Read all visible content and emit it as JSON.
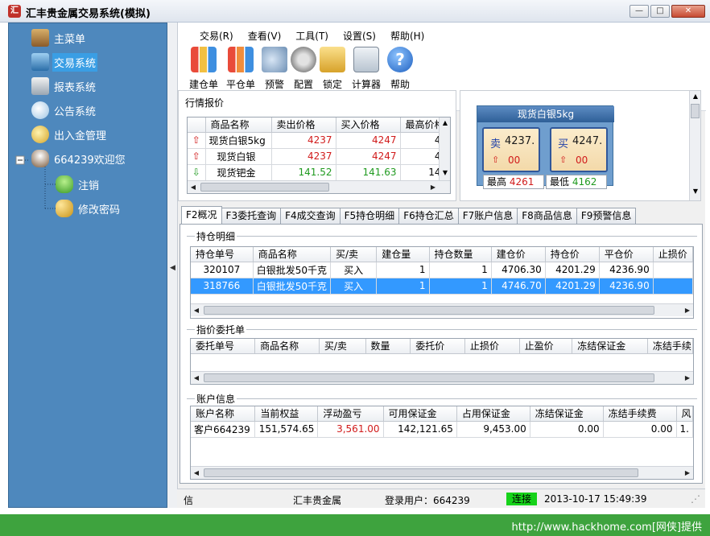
{
  "window": {
    "app_icon": "汇",
    "title": "汇丰贵金属交易系统(模拟)",
    "btn_min": "—",
    "btn_max": "□",
    "btn_close": "✕"
  },
  "sidebar": {
    "items": [
      {
        "label": "主菜单",
        "icon": "home-icon"
      },
      {
        "label": "交易系统",
        "icon": "monitor-icon"
      },
      {
        "label": "报表系统",
        "icon": "report-icon"
      },
      {
        "label": "公告系统",
        "icon": "chat-bubble-icon"
      },
      {
        "label": "出入金管理",
        "icon": "coins-icon"
      },
      {
        "label": "664239欢迎您",
        "icon": "cup-icon"
      },
      {
        "label": "注销",
        "icon": "user-icon"
      },
      {
        "label": "修改密码",
        "icon": "key-icon"
      }
    ],
    "selected": "交易系统"
  },
  "menubar": [
    "交易(R)",
    "查看(V)",
    "工具(T)",
    "设置(S)",
    "帮助(H)"
  ],
  "toolbar": [
    "建仓单",
    "平仓单",
    "预警",
    "配置",
    "锁定",
    "计算器",
    "帮助"
  ],
  "quotes": {
    "title": "行情报价",
    "columns": [
      "商品名称",
      "卖出价格",
      "买入价格",
      "最高价格"
    ],
    "rows": [
      {
        "dir": "up",
        "name": "现货白银5kg",
        "sell": "4237",
        "buy": "4247",
        "high": "4"
      },
      {
        "dir": "up",
        "name": "现货白银",
        "sell": "4237",
        "buy": "4247",
        "high": "4"
      },
      {
        "dir": "down",
        "name": "现货钯金",
        "sell": "141.52",
        "buy": "141.63",
        "high": "14"
      }
    ]
  },
  "ticker": {
    "title": "现货白银5kg",
    "sell_label": "卖",
    "sell_price": "4237.",
    "sell_change": "00",
    "buy_label": "买",
    "buy_price": "4247.",
    "buy_change": "00",
    "high_label": "最高",
    "high_value": "4261",
    "low_label": "最低",
    "low_value": "4162"
  },
  "tabs": [
    "F2概况",
    "F3委托查询",
    "F4成交查询",
    "F5持仓明细",
    "F6持仓汇总",
    "F7账户信息",
    "F8商品信息",
    "F9预警信息"
  ],
  "positions": {
    "title": "持仓明细",
    "columns": [
      "持仓单号",
      "商品名称",
      "买/卖",
      "建仓量",
      "持仓数量",
      "建仓价",
      "持仓价",
      "平仓价",
      "止损价"
    ],
    "rows": [
      [
        "320107",
        "白银批发50千克",
        "买入",
        "1",
        "1",
        "4706.30",
        "4201.29",
        "4236.90"
      ],
      [
        "318766",
        "白银批发50千克",
        "买入",
        "1",
        "1",
        "4746.70",
        "4201.29",
        "4236.90"
      ]
    ]
  },
  "orders": {
    "title": "指价委托单",
    "columns": [
      "委托单号",
      "商品名称",
      "买/卖",
      "数量",
      "委托价",
      "止损价",
      "止盈价",
      "冻结保证金",
      "冻结手续"
    ]
  },
  "account": {
    "title": "账户信息",
    "columns": [
      "账户名称",
      "当前权益",
      "浮动盈亏",
      "可用保证金",
      "占用保证金",
      "冻结保证金",
      "冻结手续费",
      "风"
    ],
    "rows": [
      [
        "客户664239",
        "151,574.65",
        "3,561.00",
        "142,121.65",
        "9,453.00",
        "0.00",
        "0.00",
        "1."
      ]
    ]
  },
  "status": {
    "left": "信",
    "company": "汇丰贵金属",
    "user": "登录用户：664239",
    "connection": "连接",
    "datetime": "2013-10-17 15:49:39"
  },
  "footer": "http://www.hackhome.com[网侠]提供"
}
